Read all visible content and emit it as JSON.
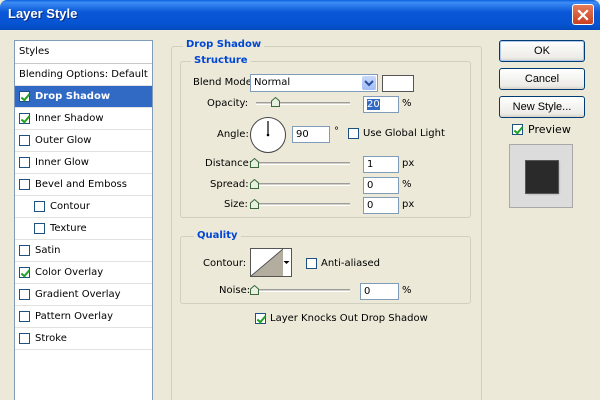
{
  "window": {
    "title": "Layer Style"
  },
  "sidebar": {
    "header": "Styles",
    "blending": "Blending Options: Default",
    "items": [
      {
        "label": "Drop Shadow",
        "checked": true,
        "selected": true,
        "indent": false
      },
      {
        "label": "Inner Shadow",
        "checked": true,
        "selected": false,
        "indent": false
      },
      {
        "label": "Outer Glow",
        "checked": false,
        "selected": false,
        "indent": false
      },
      {
        "label": "Inner Glow",
        "checked": false,
        "selected": false,
        "indent": false
      },
      {
        "label": "Bevel and Emboss",
        "checked": false,
        "selected": false,
        "indent": false
      },
      {
        "label": "Contour",
        "checked": false,
        "selected": false,
        "indent": true
      },
      {
        "label": "Texture",
        "checked": false,
        "selected": false,
        "indent": true
      },
      {
        "label": "Satin",
        "checked": false,
        "selected": false,
        "indent": false
      },
      {
        "label": "Color Overlay",
        "checked": true,
        "selected": false,
        "indent": false
      },
      {
        "label": "Gradient Overlay",
        "checked": false,
        "selected": false,
        "indent": false
      },
      {
        "label": "Pattern Overlay",
        "checked": false,
        "selected": false,
        "indent": false
      },
      {
        "label": "Stroke",
        "checked": false,
        "selected": false,
        "indent": false
      }
    ]
  },
  "drop_shadow": {
    "title": "Drop Shadow",
    "structure": {
      "title": "Structure",
      "blend_mode_label": "Blend Mode:",
      "blend_mode_value": "Normal",
      "opacity_label": "Opacity:",
      "opacity_value": "20",
      "opacity_unit": "%",
      "opacity_fraction": 0.2,
      "angle_label": "Angle:",
      "angle_value": "90",
      "angle_unit": "°",
      "use_global_light_label": "Use Global Light",
      "use_global_light_checked": false,
      "distance_label": "Distance:",
      "distance_value": "1",
      "distance_unit": "px",
      "spread_label": "Spread:",
      "spread_value": "0",
      "spread_unit": "%",
      "size_label": "Size:",
      "size_value": "0",
      "size_unit": "px"
    },
    "quality": {
      "title": "Quality",
      "contour_label": "Contour:",
      "anti_aliased_label": "Anti-aliased",
      "anti_aliased_checked": false,
      "noise_label": "Noise:",
      "noise_value": "0",
      "noise_unit": "%"
    },
    "knocks_out_label": "Layer Knocks Out Drop Shadow",
    "knocks_out_checked": true
  },
  "buttons": {
    "ok": "OK",
    "cancel": "Cancel",
    "new_style": "New Style...",
    "preview_label": "Preview",
    "preview_checked": true
  },
  "colors": {
    "selection": "#316ac5",
    "legend": "#0046d5",
    "dialog_bg": "#ece9d8",
    "shadow_color": "#ffffff",
    "preview_swatch": "#2a2a2a"
  },
  "icons": {
    "close": "close-x-icon",
    "check": "checkmark-icon",
    "dropdown": "chevron-down-icon",
    "slider": "slider-thumb-icon",
    "angle": "angle-dial-icon",
    "contour": "contour-curve-icon"
  }
}
